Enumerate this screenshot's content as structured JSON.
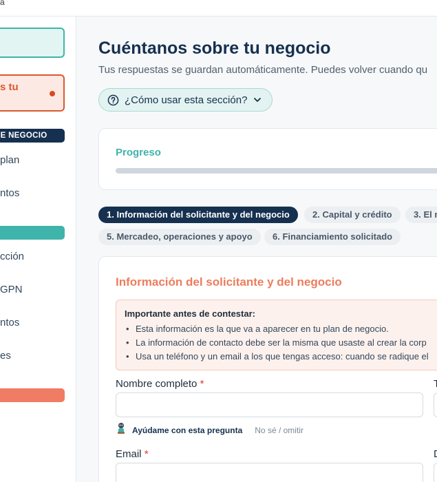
{
  "topbar": {
    "cut_text": "a"
  },
  "sidebar": {
    "alert_item": {
      "label": "s tu"
    },
    "section_header": "DE NEGOCIO",
    "items": [
      {
        "label": "plan"
      },
      {
        "label": "ntos"
      },
      {
        "label": "cción"
      },
      {
        "label": "GPN"
      },
      {
        "label": "ntos"
      },
      {
        "label": "es"
      }
    ]
  },
  "header": {
    "title": "Cuéntanos sobre tu negocio",
    "subtitle": "Tus respuestas se guardan automáticamente. Puedes volver cuando qu"
  },
  "help_button": {
    "label": "¿Cómo usar esta sección?",
    "icon": "question-circle-icon"
  },
  "progress": {
    "label": "Progreso",
    "value_percent": 0
  },
  "tabs": [
    {
      "label": "1. Información del solicitante y del negocio",
      "active": true
    },
    {
      "label": "2. Capital y crédito",
      "active": false
    },
    {
      "label": "3. El n",
      "active": false
    },
    {
      "label": "5. Mercadeo, operaciones y apoyo",
      "active": false
    },
    {
      "label": "6. Financiamiento solicitado",
      "active": false
    }
  ],
  "form": {
    "title": "Información del solicitante y del negocio",
    "notice": {
      "title": "Importante antes de contestar:",
      "items": [
        "Esta información es la que va a aparecer en tu plan de negocio.",
        "La información de contacto debe ser la misma que usaste al crear la corp",
        "Usa un teléfono y un email a los que tengas acceso: cuando se radique el"
      ]
    },
    "fields": {
      "full_name": {
        "label": "Nombre completo",
        "required_mark": "*",
        "value": ""
      },
      "right_col_1": {
        "label": "T"
      },
      "email": {
        "label": "Email",
        "required_mark": "*",
        "value": ""
      },
      "right_col_2": {
        "label": "D"
      }
    },
    "helper": {
      "help_label": "Ayúdame con esta pregunta",
      "skip_label": "No sé / omitir"
    }
  },
  "colors": {
    "navy": "#16304f",
    "teal": "#3fb4aa",
    "orange": "#ec7d5c",
    "alert_red": "#d9582e",
    "required_red": "#e0352b"
  }
}
